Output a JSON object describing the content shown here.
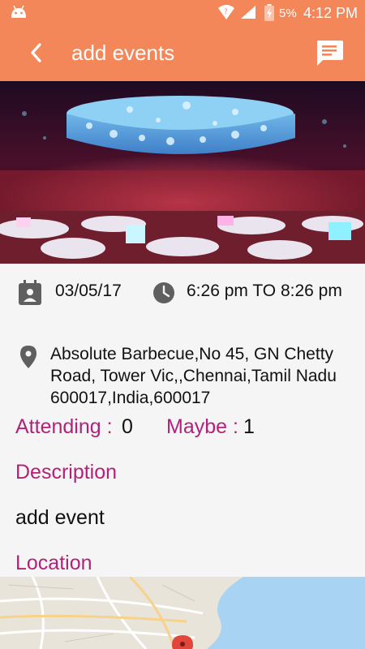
{
  "status_bar": {
    "battery": "5%",
    "time": "4:12 PM"
  },
  "app_bar": {
    "title": "add events"
  },
  "event": {
    "date": "03/05/17",
    "time_range": "6:26 pm TO 8:26 pm",
    "address": "Absolute Barbecue,No 45, GN Chetty Road, Tower Vic,,Chennai,Tamil Nadu 600017,India,600017",
    "attending_label": "Attending :",
    "attending_count": "0",
    "maybe_label": "Maybe :",
    "maybe_count": "1",
    "description_heading": "Description",
    "description_text": "add event",
    "location_heading": "Location"
  },
  "colors": {
    "accent": "#f48759",
    "label": "#b1237a",
    "icon": "#5f5f5f"
  }
}
